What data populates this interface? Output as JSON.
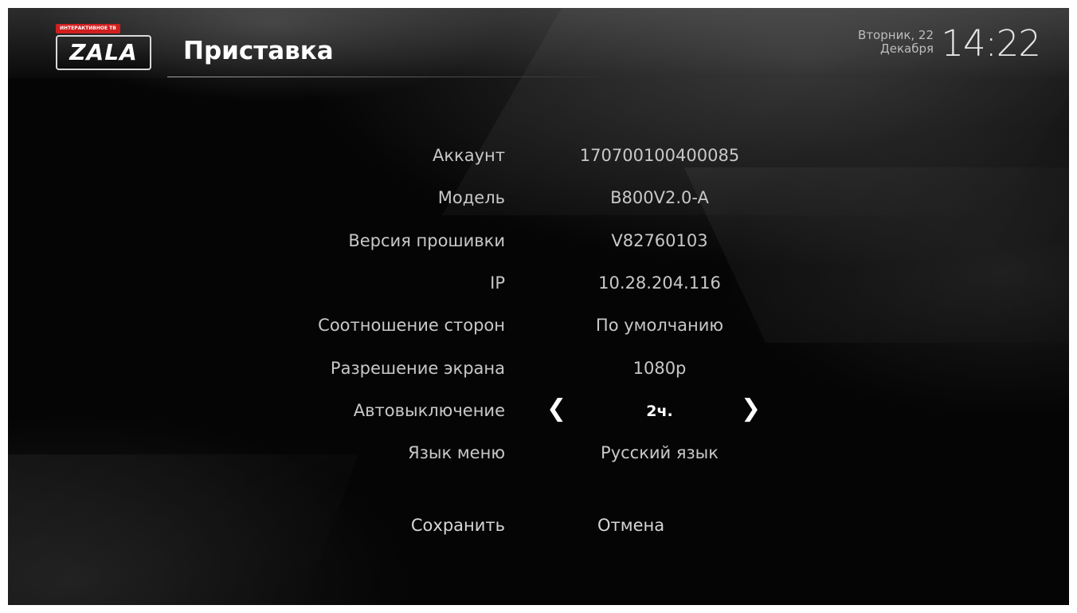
{
  "header": {
    "logo_tag": "ИНТЕРАКТИВНОЕ ТВ",
    "logo_text": "ZALA",
    "title": "Приставка",
    "date_line1": "Вторник, 22",
    "date_line2": "Декабря",
    "time": "14:22"
  },
  "settings": [
    {
      "label": "Аккаунт",
      "value": "170700100400085"
    },
    {
      "label": "Модель",
      "value": "B800V2.0-A"
    },
    {
      "label": "Версия прошивки",
      "value": "V82760103"
    },
    {
      "label": "IP",
      "value": "10.28.204.116"
    },
    {
      "label": "Соотношение сторон",
      "value": "По умолчанию"
    },
    {
      "label": "Разрешение экрана",
      "value": "1080p"
    },
    {
      "label": "Автовыключение",
      "value": "2ч."
    },
    {
      "label": "Язык меню",
      "value": "Русский язык"
    }
  ],
  "actions": {
    "save_label": "Сохранить",
    "cancel_label": "Отмена"
  },
  "icons": {
    "prev": "chevron-left-icon",
    "next": "chevron-right-icon"
  },
  "colors": {
    "background": "#050505",
    "text": "#c8c8c8",
    "highlight": "#ffffff",
    "logo_red": "#d11f1f"
  }
}
